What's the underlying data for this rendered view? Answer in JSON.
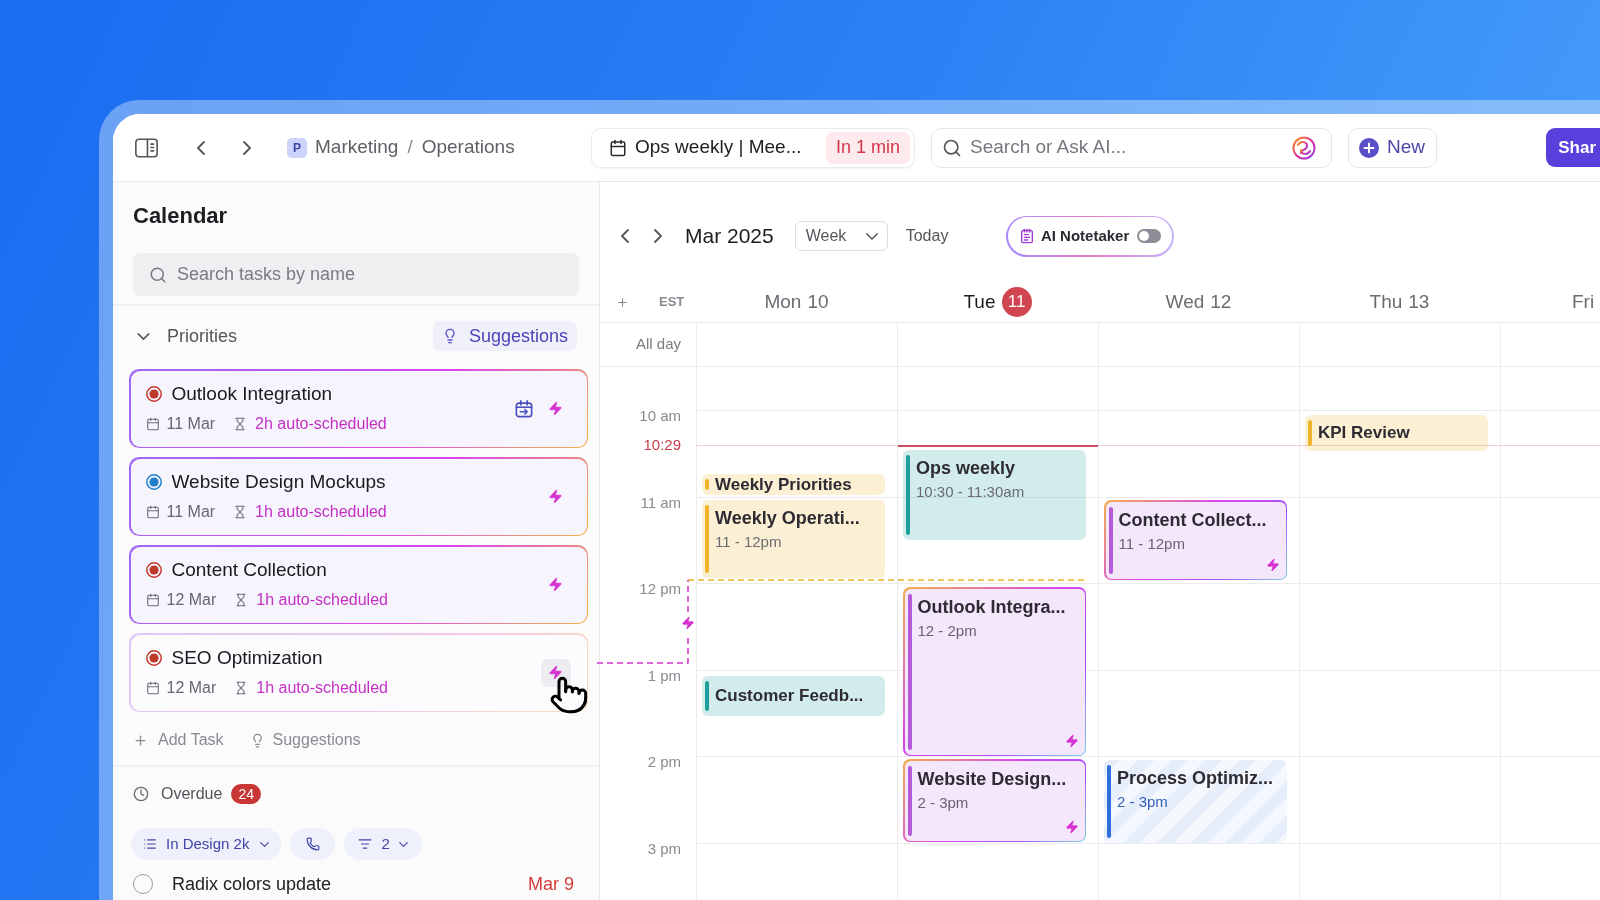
{
  "toolbar": {
    "breadcrumb": {
      "badge": "P",
      "items": [
        "Marketing",
        "Operations"
      ],
      "separator": "/"
    },
    "meeting": {
      "title": "Ops weekly | Mee...",
      "badge": "In 1 min"
    },
    "search": {
      "placeholder": "Search or Ask AI..."
    },
    "new_button": "New",
    "share_button": "Shar"
  },
  "sidebar": {
    "title": "Calendar",
    "search": {
      "placeholder": "Search tasks by name"
    },
    "priorities": {
      "label": "Priorities",
      "expanded": true,
      "suggestions_button": "Suggestions",
      "tasks": [
        {
          "name": "Outlook Integration",
          "color": "#c0392b",
          "date": "11 Mar",
          "schedule": "2h auto-scheduled",
          "calendar_link": true,
          "hovered": false
        },
        {
          "name": "Website Design Mockups",
          "color": "#1f7fc8",
          "date": "11 Mar",
          "schedule": "1h auto-scheduled",
          "calendar_link": false,
          "hovered": false
        },
        {
          "name": "Content Collection",
          "color": "#c0392b",
          "date": "12 Mar",
          "schedule": "1h auto-scheduled",
          "calendar_link": false,
          "hovered": false
        },
        {
          "name": "SEO Optimization",
          "color": "#c0392b",
          "date": "12 Mar",
          "schedule": "1h auto-scheduled",
          "calendar_link": false,
          "hovered": true
        }
      ]
    },
    "add_task": "Add Task",
    "suggestions_link": "Suggestions",
    "overdue": {
      "label": "Overdue",
      "count": "24"
    },
    "filters": [
      {
        "kind": "group",
        "label": "In Design 2k"
      },
      {
        "kind": "call"
      },
      {
        "kind": "filter",
        "label": "2"
      }
    ],
    "overdue_tasks": [
      {
        "name": "Radix colors update",
        "date": "Mar 9",
        "checked": false
      }
    ]
  },
  "calendar": {
    "month": "Mar 2025",
    "view": "Week",
    "today_button": "Today",
    "notetaker": {
      "label": "AI Notetaker",
      "on": false
    },
    "timezone": "EST",
    "all_day_label": "All day",
    "hours": [
      "10 am",
      "11 am",
      "12 pm",
      "1 pm",
      "2 pm",
      "3 pm"
    ],
    "now": "10:29",
    "days": [
      {
        "weekday": "Mon",
        "date": "10",
        "today": false,
        "events": [
          {
            "kind": "event",
            "title": "Weekly Priorities",
            "color": "#f0b429"
          },
          {
            "kind": "event",
            "title": "Weekly Operati...",
            "time": "11 - 12pm",
            "color": "#f0b429"
          },
          {
            "kind": "event",
            "title": "Customer Feedb...",
            "color": "#1f9e9e"
          }
        ]
      },
      {
        "weekday": "Tue",
        "date": "11",
        "today": true,
        "events": [
          {
            "kind": "event",
            "title": "Ops weekly",
            "time": "10:30 - 11:30am",
            "color": "#1f9e9e"
          },
          {
            "kind": "auto",
            "title": "Outlook Integra...",
            "time": "12 - 2pm",
            "color": "#b45bd9"
          },
          {
            "kind": "auto",
            "title": "Website Design...",
            "time": "2 - 3pm",
            "color": "#b45bd9"
          }
        ]
      },
      {
        "weekday": "Wed",
        "date": "12",
        "today": false,
        "events": [
          {
            "kind": "auto",
            "title": "Content Collect...",
            "time": "11 - 12pm",
            "color": "#b45bd9"
          },
          {
            "kind": "tentative",
            "title": "Process Optimiz...",
            "time": "2 - 3pm",
            "color": "#2f6fdc"
          }
        ]
      },
      {
        "weekday": "Thu",
        "date": "13",
        "today": false,
        "events": [
          {
            "kind": "event",
            "title": "KPI Review",
            "color": "#f0b429"
          }
        ]
      },
      {
        "weekday": "Fri",
        "today": false
      }
    ]
  }
}
